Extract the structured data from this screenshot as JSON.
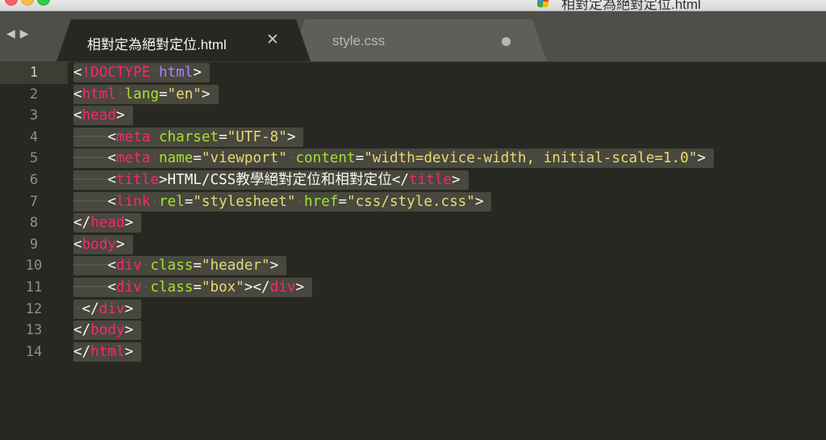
{
  "window": {
    "title": "相對定為絕對定位.html"
  },
  "tabs": [
    {
      "label": "相對定為絕對定位.html",
      "active": true,
      "close_icon": "close-icon"
    },
    {
      "label": "style.css",
      "active": false,
      "modified": true
    }
  ],
  "nav": {
    "back_icon": "chevron-left-icon",
    "forward_icon": "chevron-right-icon"
  },
  "editor": {
    "current_line": 1,
    "syntax_colors": {
      "tag": "#f92672",
      "attribute": "#a6e22e",
      "string": "#e6db74",
      "keyword": "#ae81ff",
      "text": "#f8f8f2",
      "background": "#272822"
    },
    "lines": [
      {
        "number": "1",
        "text": "<!DOCTYPE html>"
      },
      {
        "number": "2",
        "text": "<html lang=\"en\">"
      },
      {
        "number": "3",
        "text": "<head>"
      },
      {
        "number": "4",
        "text": "    <meta charset=\"UTF-8\">"
      },
      {
        "number": "5",
        "text": "    <meta name=\"viewport\" content=\"width=device-width, initial-scale=1.0\">"
      },
      {
        "number": "6",
        "text": "    <title>HTML/CSS教學絕對定位和相對定位</title>"
      },
      {
        "number": "7",
        "text": "    <link rel=\"stylesheet\" href=\"css/style.css\">"
      },
      {
        "number": "8",
        "text": "</head>"
      },
      {
        "number": "9",
        "text": "<body>"
      },
      {
        "number": "10",
        "text": "    <div class=\"header\">"
      },
      {
        "number": "11",
        "text": "    <div class=\"box\"></div>"
      },
      {
        "number": "12",
        "text": " </div>"
      },
      {
        "number": "13",
        "text": "</body>"
      },
      {
        "number": "14",
        "text": "</html>"
      }
    ]
  }
}
